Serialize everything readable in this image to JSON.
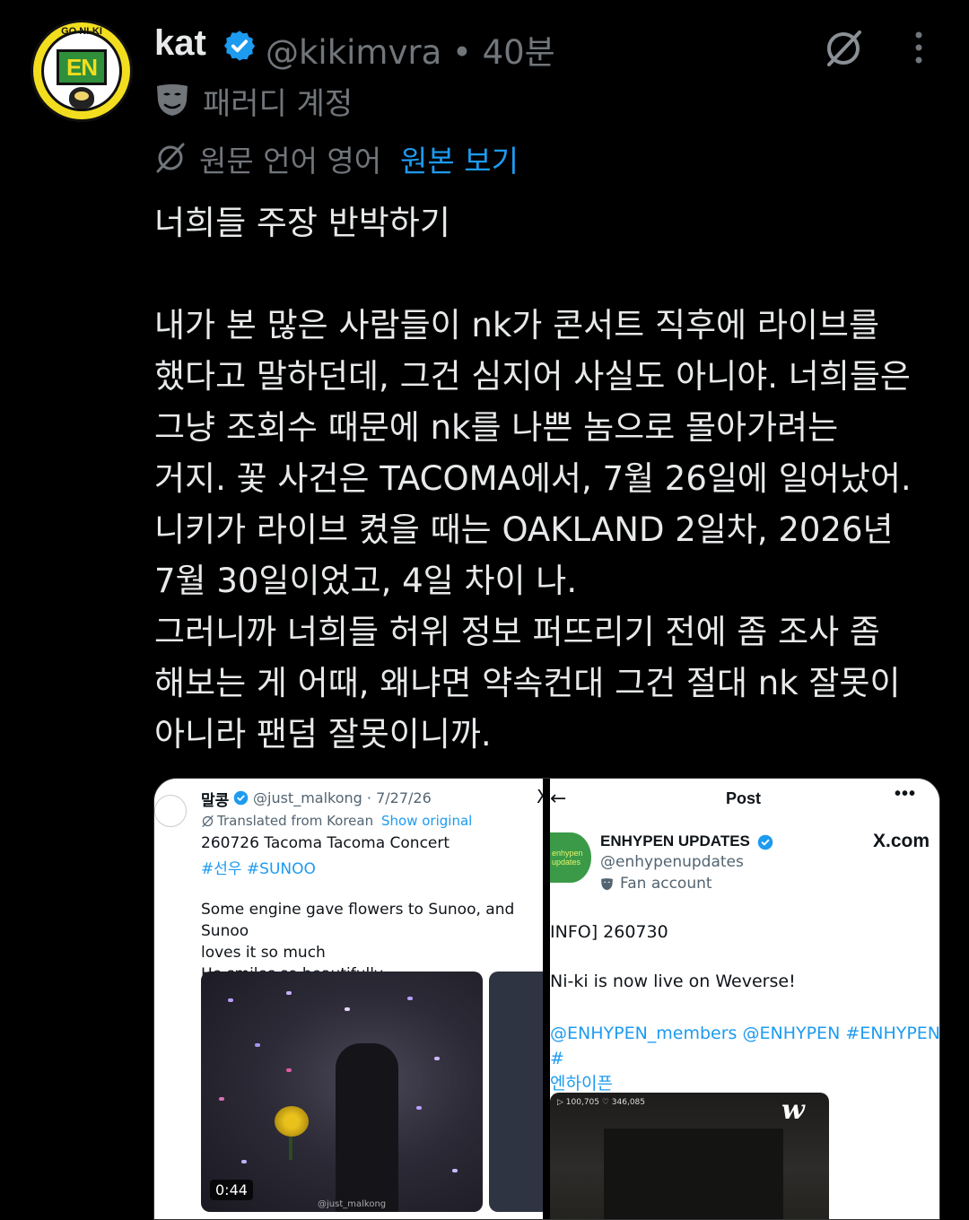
{
  "tweet": {
    "name": "kat",
    "handle_time": "@kikimvra • 40분",
    "parody_label": "패러디 계정",
    "language_label": "원문 언어 영어",
    "show_original": "원본 보기",
    "text": "너희들 주장 반박하기\n\n내가 본 많은 사람들이 nk가 콘서트 직후에 라이브를\n했다고 말하던데, 그건 심지어 사실도 아니야. 너희들은\n그냥 조회수 때문에 nk를 나쁜 놈으로 몰아가려는\n거지. 꽃 사건은 TACOMA에서, 7월 26일에 일어났어.\n니키가 라이브 켰을 때는 OAKLAND 2일차, 2026년\n7월 30일이었고, 4일 차이 나.\n그러니까 너희들 허위 정보 퍼뜨리기 전에 좀 조사 좀\n해보는 게 어때, 왜냐면 약속컨대 그건 절대 nk 잘못이\n아니라 팬덤 잘못이니까.",
    "avatar_text": "EN",
    "avatar_arc_text": "GO NI-KI",
    "colors": {
      "accent": "#1d9bf0",
      "muted": "#71767b",
      "background": "#000000",
      "text": "#e7e9ea"
    }
  },
  "left_screenshot": {
    "name": "말콩",
    "handle_date": "@just_malkong · 7/27/26",
    "x_mark": "X",
    "translated_label": "Translated from Korean",
    "show_original": "Show original",
    "title": "260726 Tacoma Tacoma Concert",
    "tags": "#선우 #SUNOO",
    "body": "Some engine gave flowers to Sunoo, and Sunoo\nloves it so much\nHe smiles so beautifully..",
    "video_duration": "0:44",
    "watermark": "@just_malkong"
  },
  "right_screenshot": {
    "back_icon": "←",
    "title": "Post",
    "more_icon": "•••",
    "avatar_text": "enhypen updates",
    "name": "ENHYPEN UPDATES",
    "site": "X.com",
    "handle": "@enhypenupdates",
    "fan_label": "Fan account",
    "info": "INFO] 260730",
    "live": "Ni-ki is now live on Weverse!",
    "tags": "@ENHYPEN_members @ENHYPEN #ENHYPEN #\n엔하이픈",
    "video_stats": "▷ 100,705  ♡ 346,085",
    "weverse_logo": "w"
  }
}
